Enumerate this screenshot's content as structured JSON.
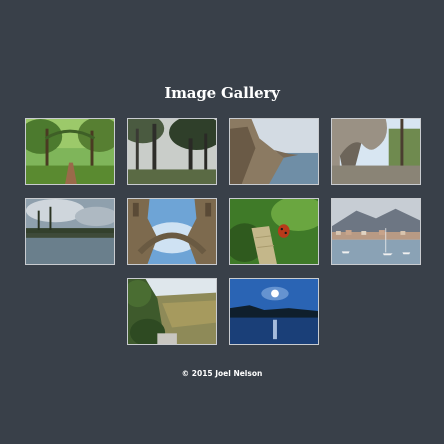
{
  "page": {
    "title": "Image Gallery",
    "footer": "© 2015 Joel Nelson"
  },
  "gallery": {
    "images": [
      {
        "name": "forest-path"
      },
      {
        "name": "misty-trees"
      },
      {
        "name": "coastal-cliffs"
      },
      {
        "name": "rock-arch"
      },
      {
        "name": "lake-reflection"
      },
      {
        "name": "stone-arch-sky"
      },
      {
        "name": "ladybug-leaf"
      },
      {
        "name": "harbor-village"
      },
      {
        "name": "valley-hills"
      },
      {
        "name": "moonlit-lake"
      }
    ]
  }
}
